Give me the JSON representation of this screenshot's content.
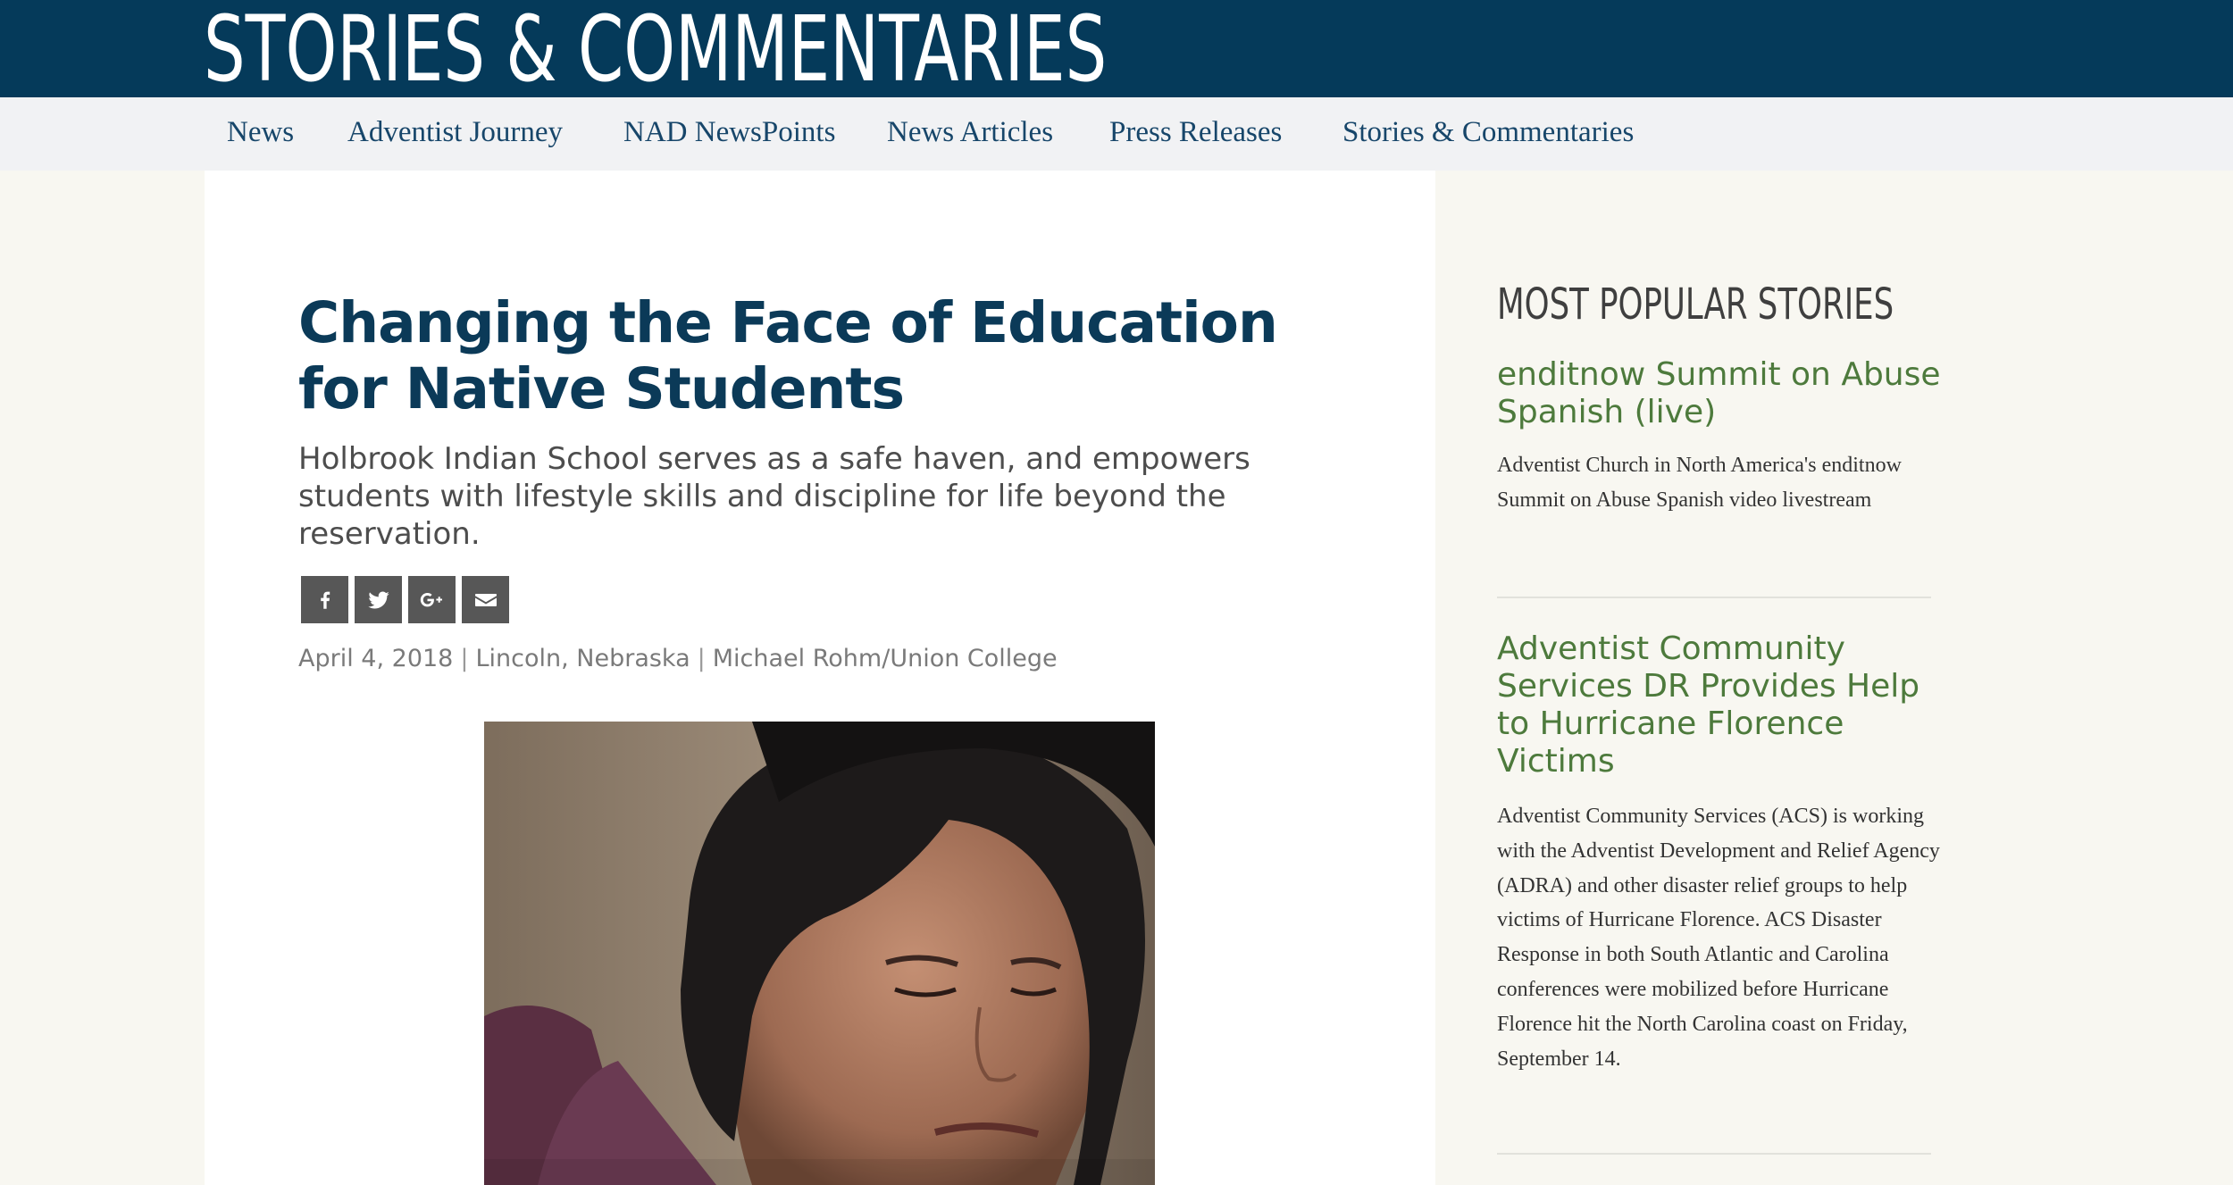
{
  "header": {
    "section_title": "STORIES & COMMENTARIES"
  },
  "nav": {
    "items": [
      {
        "label": "News"
      },
      {
        "label": "Adventist Journey"
      },
      {
        "label": "NAD NewsPoints"
      },
      {
        "label": "News Articles"
      },
      {
        "label": "Press Releases"
      },
      {
        "label": "Stories & Commentaries"
      }
    ]
  },
  "article": {
    "title": "Changing the Face of Education for Native Students",
    "subtitle": "Holbrook Indian School serves as a safe haven, and empowers students with lifestyle skills and discipline for life beyond the reservation.",
    "share": {
      "icons": [
        "facebook-icon",
        "twitter-icon",
        "google-plus-icon",
        "email-icon"
      ]
    },
    "meta": {
      "date": "April 4, 2018",
      "location": "Lincoln, Nebraska",
      "author": "Michael Rohm/Union College",
      "separator": "|"
    }
  },
  "sidebar": {
    "heading": "MOST POPULAR STORIES",
    "stories": [
      {
        "title": "enditnow Summit on Abuse Spanish (live)",
        "summary": "Adventist Church in North America's enditnow Summit on Abuse Spanish video livestream"
      },
      {
        "title": "Adventist Community Services DR Provides Help to Hurricane Florence Victims",
        "summary": "Adventist Community Services (ACS) is working with the Adventist Development and Relief Agency (ADRA) and other disaster relief groups to help victims of Hurricane Florence. ACS Disaster Response in both South Atlantic and Carolina conferences were mobilized before Hurricane Florence hit the North Carolina coast on Friday, September 14."
      }
    ]
  },
  "colors": {
    "header_bg": "#053a5a",
    "nav_bg": "#f1f2f4",
    "nav_link": "#17466a",
    "title": "#0b3a58",
    "story_link": "#4d7a3c",
    "page_bg": "#f8f7f1",
    "share_btn": "#575757"
  }
}
